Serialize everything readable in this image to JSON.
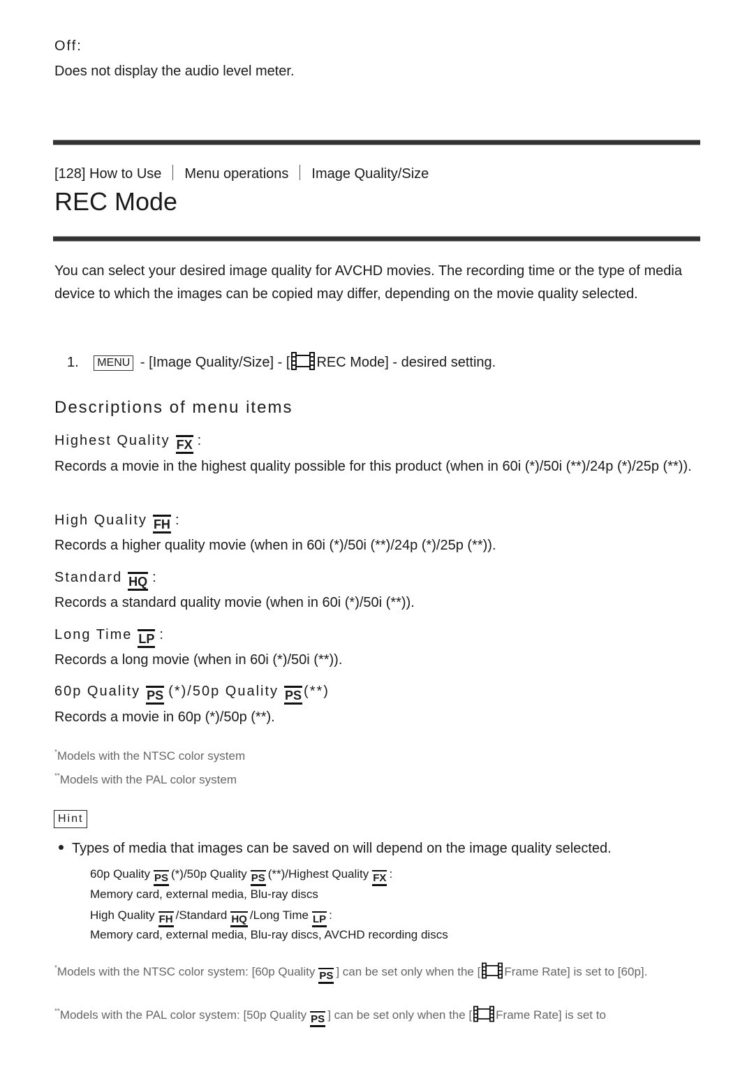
{
  "prev_section": {
    "label": "Off:",
    "description": "Does not display the audio level meter."
  },
  "breadcrumb": {
    "number": "[128]",
    "items": [
      "How to Use",
      "Menu operations",
      "Image Quality/Size"
    ]
  },
  "page_title": "REC Mode",
  "intro": "You can select your desired image quality for AVCHD movies. The recording time or the type of media device to which the images can be copied may differ, depending on the movie quality selected.",
  "steps": [
    {
      "number": "1.",
      "menu_button": "MENU",
      "text_before_icon": " - [Image Quality/Size] - [",
      "text_after_icon": "REC Mode] - desired setting."
    }
  ],
  "descriptions_heading": "Descriptions of menu items",
  "menu_items": [
    {
      "label": "Highest Quality",
      "badge": "FX",
      "suffix": ":",
      "description": "Records a movie in the highest quality possible for this product (when in 60i (*)/50i (**)/24p (*)/25p (**))."
    },
    {
      "label": "High Quality",
      "badge": "FH",
      "suffix": ":",
      "description": "Records a higher quality movie (when in 60i (*)/50i (**)/24p (*)/25p (**))."
    },
    {
      "label": "Standard",
      "badge": "HQ",
      "suffix": ":",
      "description": "Records a standard quality movie (when in 60i (*)/50i (**))."
    },
    {
      "label": "Long Time",
      "badge": "LP",
      "suffix": ":",
      "description": "Records a long movie (when in 60i (*)/50i (**))."
    },
    {
      "label": "60p Quality",
      "badge": "PS",
      "middle": "(*)/50p Quality",
      "badge2": "PS",
      "suffix": "(**)",
      "description": "Records a movie in 60p (*)/50p (**)."
    }
  ],
  "notes": [
    {
      "marker": "*",
      "text": "Models with the NTSC color system"
    },
    {
      "marker": "**",
      "text": "Models with the PAL color system"
    }
  ],
  "hint": {
    "label": "Hint",
    "bullet": "Types of media that images can be saved on will depend on the image quality selected.",
    "groups": [
      {
        "parts": [
          "60p Quality",
          "PS",
          "(*)/50p Quality",
          "PS",
          "(**)/Highest Quality",
          "FX",
          ":"
        ],
        "media": "Memory card, external media, Blu-ray discs"
      },
      {
        "parts": [
          "High Quality",
          "FH",
          "/Standard",
          "HQ",
          "/Long Time",
          "LP",
          ":"
        ],
        "media": "Memory card, external media, Blu-ray discs, AVCHD recording discs"
      }
    ]
  },
  "footnotes": [
    {
      "marker": "*",
      "before": "Models with the NTSC color system: [60p Quality",
      "badge": "PS",
      "middle": "] can be set only when the [",
      "after": "Frame Rate] is set to [60p]."
    },
    {
      "marker": "**",
      "before": "Models with the PAL color system: [50p Quality",
      "badge": "PS",
      "middle": "] can be set only when the [",
      "after": "Frame Rate] is set to"
    }
  ]
}
